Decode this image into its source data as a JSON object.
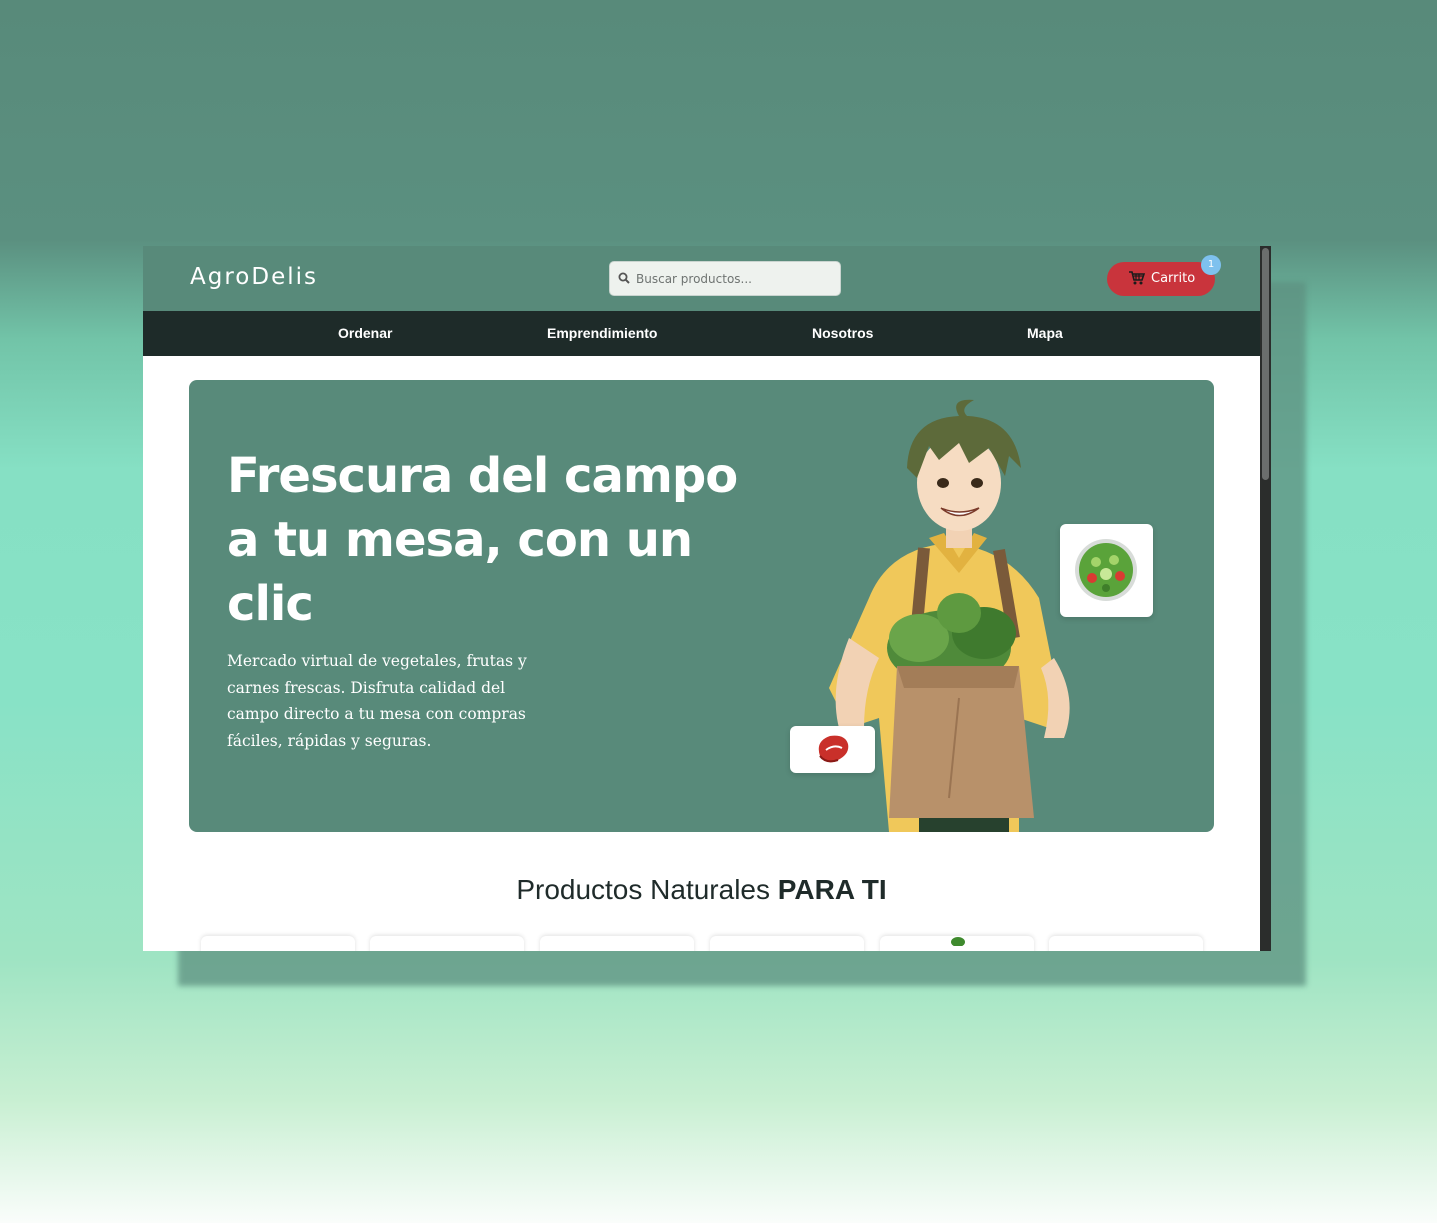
{
  "header": {
    "logo": "AgroDelis",
    "search_placeholder": "Buscar productos...",
    "cart_label": "Carrito",
    "cart_count": "1"
  },
  "nav": {
    "items": [
      {
        "label": "Ordenar"
      },
      {
        "label": "Emprendimiento"
      },
      {
        "label": "Nosotros"
      },
      {
        "label": "Mapa"
      }
    ]
  },
  "hero": {
    "title": "Frescura del campo a tu mesa, con un clic",
    "description": "Mercado virtual de vegetales, frutas y carnes frescas. Disfruta calidad del campo directo a tu mesa con compras fáciles, rápidas y seguras."
  },
  "products": {
    "title_regular": "Productos Naturales",
    "title_bold": "PARA TI"
  },
  "colors": {
    "header_bg": "#588a7a",
    "nav_bg": "#1e2b29",
    "cart_button": "#c9343c",
    "badge": "#7ec1ee"
  },
  "icons": [
    "search-icon",
    "cart-icon",
    "salad-icon",
    "steak-icon"
  ]
}
